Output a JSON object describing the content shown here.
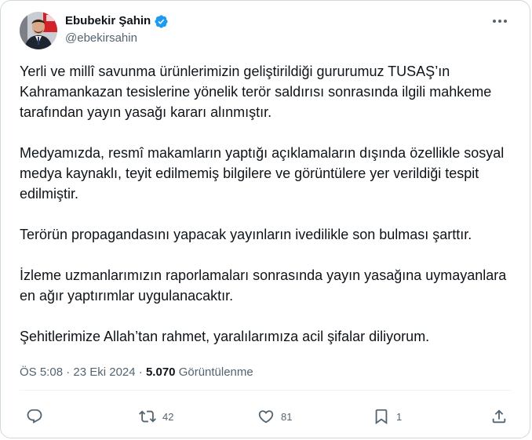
{
  "author": {
    "display_name": "Ebubekir Şahin",
    "handle": "@ebekirsahin"
  },
  "tweet": {
    "paragraphs": [
      "Yerli ve millî savunma ürünlerimizin geliştirildiği gururumuz TUSAŞ’ın Kahramankazan tesislerine yönelik terör saldırısı sonrasında ilgili mahkeme tarafından yayın yasağı kararı alınmıştır.",
      "Medyamızda, resmî makamların yaptığı açıklamaların dışında özellikle sosyal medya kaynaklı, teyit edilmemiş bilgilere ve görüntülere yer verildiği tespit edilmiştir.",
      "Terörün propagandasını yapacak yayınların ivedilikle son bulması şarttır.",
      "İzleme uzmanlarımızın raporlamaları sonrasında yayın yasağına uymayanlara en ağır yaptırımlar uygulanacaktır.",
      "Şehitlerimize Allah’tan rahmet, yaralılarımıza acil şifalar diliyorum."
    ]
  },
  "meta": {
    "time": "ÖS 5:08",
    "separator": "·",
    "date": "23 Eki 2024",
    "views_count": "5.070",
    "views_label": "Görüntülenme"
  },
  "actions": {
    "reply_count": "",
    "retweet_count": "42",
    "like_count": "81",
    "bookmark_count": "1"
  },
  "icons": {
    "verified": "verified-badge-icon",
    "more": "more-dots-icon",
    "reply": "reply-bubble-icon",
    "retweet": "retweet-arrows-icon",
    "like": "heart-icon",
    "bookmark": "bookmark-icon",
    "share": "share-upload-icon"
  },
  "colors": {
    "primary_text": "#0f1419",
    "secondary_text": "#536471",
    "verified_blue": "#1d9bf0",
    "border": "#cfd9de"
  }
}
